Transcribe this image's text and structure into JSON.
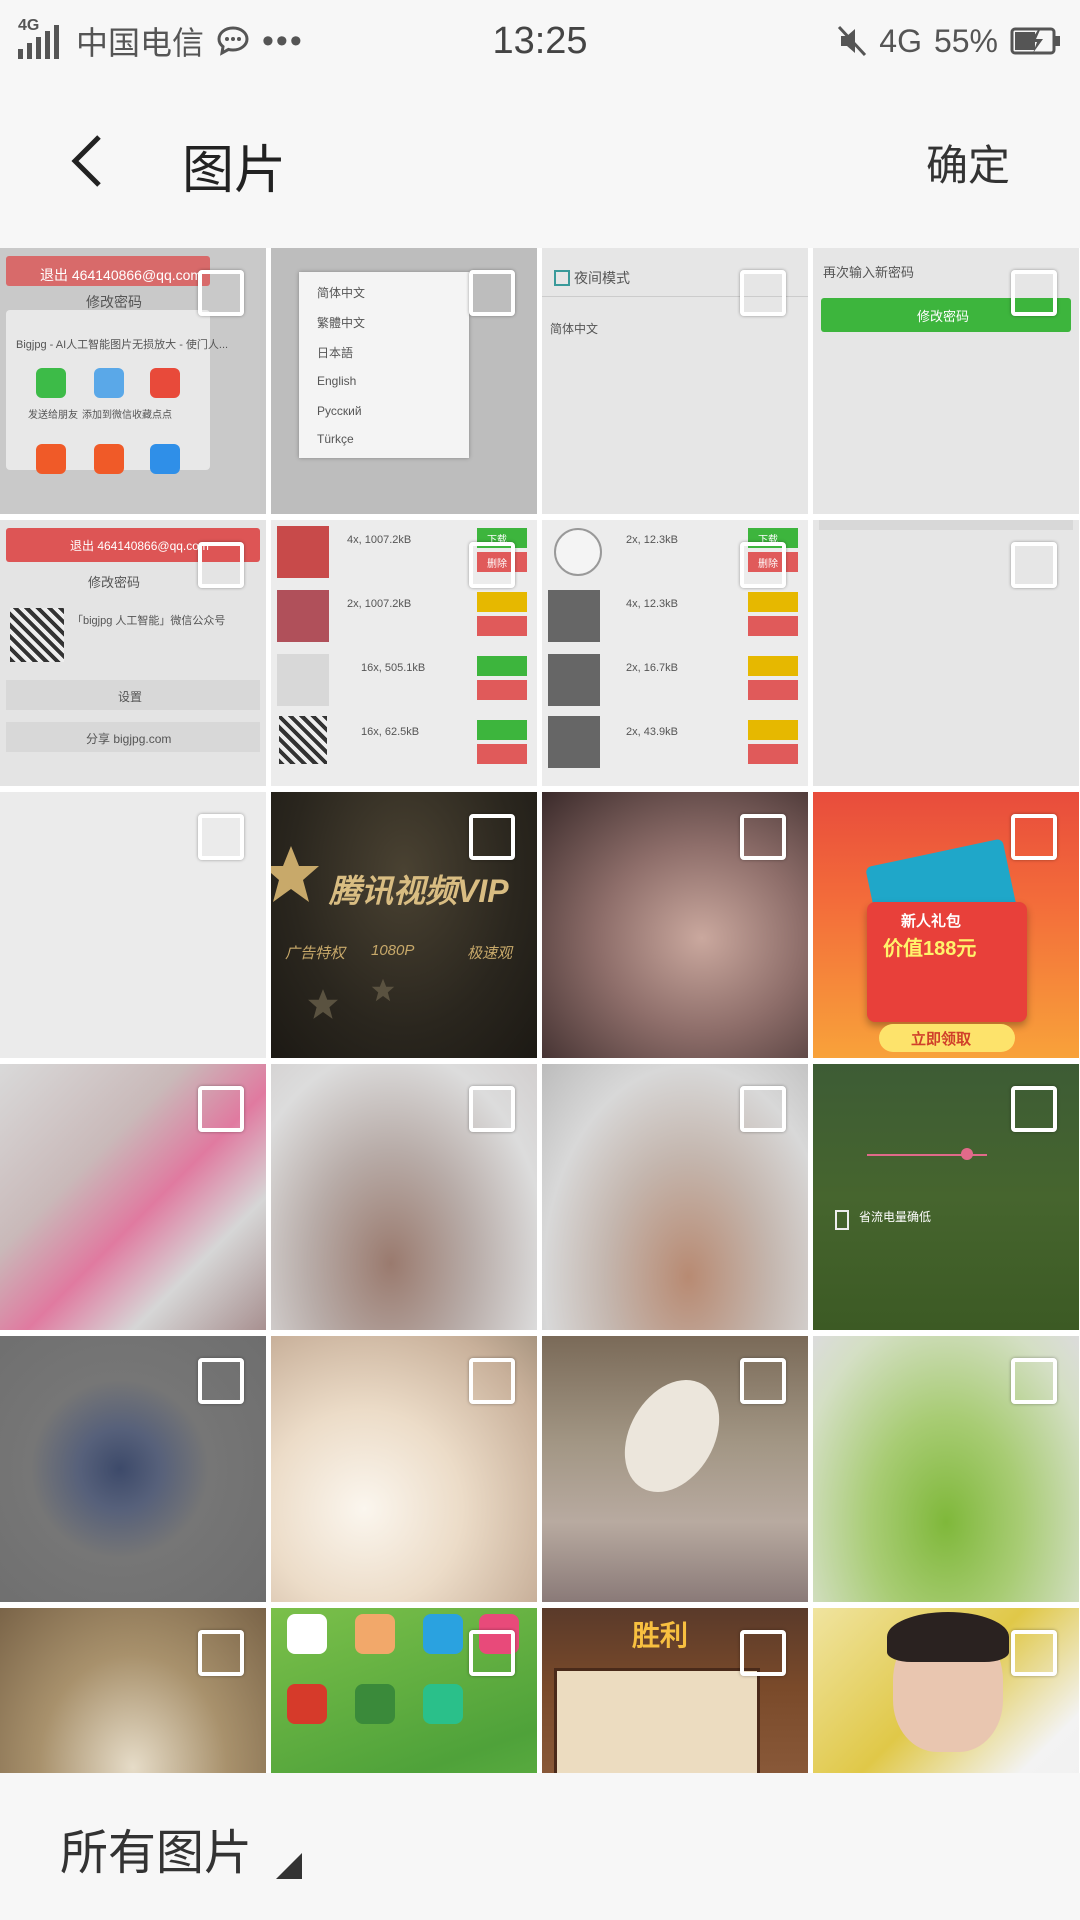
{
  "status_bar": {
    "network_label": "4G",
    "carrier": "中国电信",
    "more": "•••",
    "time": "13:25",
    "network_right": "4G",
    "battery": "55%"
  },
  "header": {
    "title": "图片",
    "confirm_label": "确定"
  },
  "thumbnails": [
    {
      "id": "t1",
      "texts": [
        "退出 464140866@qq.com",
        "修改密码",
        "Bigjpg - AI人工智能图片无损放大 - 使门人...",
        "发送给朋友",
        "添加到微信收藏",
        "点点"
      ]
    },
    {
      "id": "t2",
      "texts": [
        "简体中文",
        "繁體中文",
        "日本語",
        "English",
        "Русский",
        "Türkçe"
      ]
    },
    {
      "id": "t3",
      "texts": [
        "夜间模式",
        "简体中文"
      ]
    },
    {
      "id": "t4",
      "texts": [
        "再次输入新密码",
        "修改密码"
      ]
    },
    {
      "id": "t5",
      "texts": [
        "退出 464140866@qq.com",
        "修改密码",
        "「bigjpg 人工智能」微信公众号",
        "设置",
        "分享 bigjpg.com"
      ]
    },
    {
      "id": "t6",
      "texts": [
        "4x, 1007.2kB",
        "2x, 1007.2kB",
        "16x, 505.1kB",
        "16x, 62.5kB",
        "下载",
        "删除"
      ]
    },
    {
      "id": "t7",
      "texts": [
        "2x, 12.3kB",
        "4x, 12.3kB",
        "2x, 16.7kB",
        "2x, 43.9kB",
        "下载",
        "删除"
      ]
    },
    {
      "id": "t8",
      "texts": []
    },
    {
      "id": "t9",
      "texts": []
    },
    {
      "id": "t10",
      "texts": [
        "腾讯视频VIP",
        "广告特权",
        "1080P",
        "极速观"
      ]
    },
    {
      "id": "t11",
      "texts": []
    },
    {
      "id": "t12",
      "texts": [
        "新人礼包",
        "价值188元",
        "立即领取"
      ]
    },
    {
      "id": "t13",
      "texts": []
    },
    {
      "id": "t14",
      "texts": []
    },
    {
      "id": "t15",
      "texts": []
    },
    {
      "id": "t16",
      "texts": [
        "省流电量确低"
      ]
    },
    {
      "id": "t17",
      "texts": []
    },
    {
      "id": "t18",
      "texts": []
    },
    {
      "id": "t19",
      "texts": []
    },
    {
      "id": "t20",
      "texts": []
    },
    {
      "id": "t21",
      "texts": []
    },
    {
      "id": "t22",
      "texts": []
    },
    {
      "id": "t23",
      "texts": [
        "胜利"
      ]
    },
    {
      "id": "t24",
      "texts": []
    }
  ],
  "bottom": {
    "album_label": "所有图片"
  },
  "colors": {
    "green_button": "#3db53d",
    "red_button": "#e05a5a",
    "yellow_button": "#e6b800"
  },
  "icons": {
    "back": "chevron-left-icon",
    "checkbox": "checkbox-icon",
    "triangle": "dropdown-triangle-icon"
  }
}
